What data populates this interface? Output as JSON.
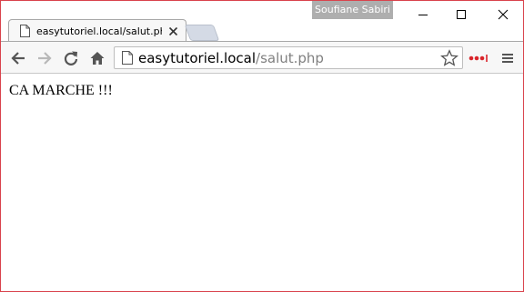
{
  "window": {
    "profile_name": "Soufiane Sabiri",
    "controls": [
      "minimize-icon",
      "maximize-icon",
      "close-icon"
    ],
    "frame_color": "#d9434c"
  },
  "tab": {
    "title": "easytutoriel.local/salut.php",
    "icon": "page-icon",
    "close_icon": "close-icon"
  },
  "toolbar": {
    "buttons": [
      "back-arrow-icon",
      "forward-arrow-icon",
      "reload-icon",
      "home-icon"
    ],
    "url_host": "easytutoriel.local",
    "url_path": "/salut.php",
    "extension_icon_color": "#d9252b"
  },
  "page": {
    "text": "CA MARCHE !!!"
  }
}
